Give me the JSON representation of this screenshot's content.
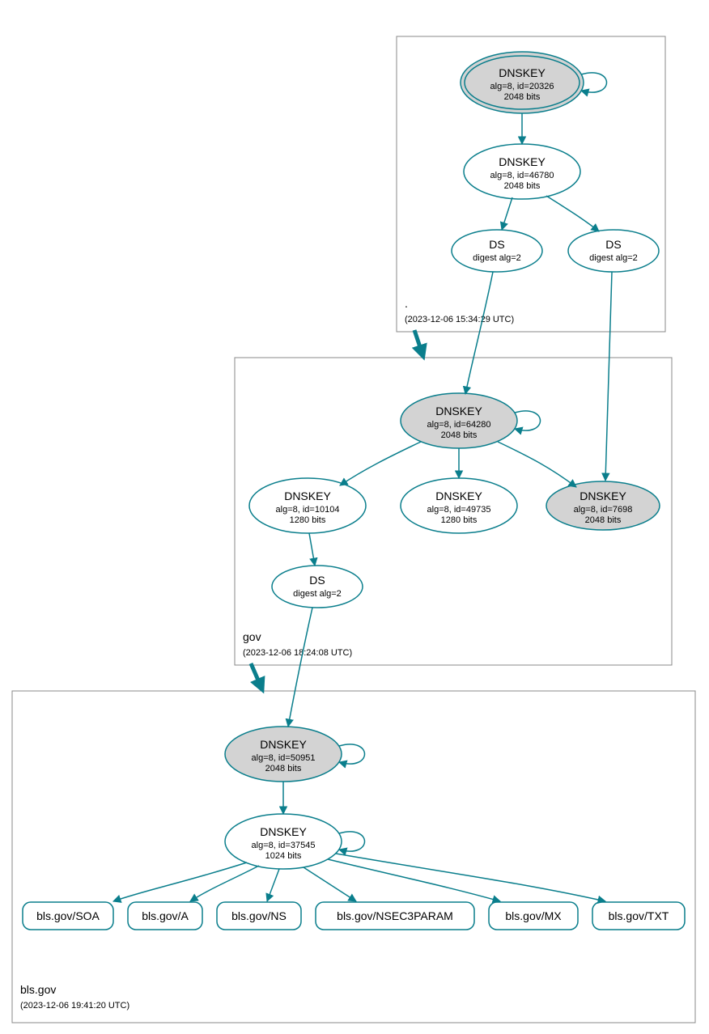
{
  "colors": {
    "stroke": "#0a7e8c",
    "fill_grey": "#d3d3d3",
    "box": "#888888"
  },
  "zones": {
    "root": {
      "label": ".",
      "timestamp": "(2023-12-06 15:34:29 UTC)",
      "nodes": {
        "ksk": {
          "title": "DNSKEY",
          "line2": "alg=8, id=20326",
          "line3": "2048 bits"
        },
        "zsk": {
          "title": "DNSKEY",
          "line2": "alg=8, id=46780",
          "line3": "2048 bits"
        },
        "ds1": {
          "title": "DS",
          "line2": "digest alg=2"
        },
        "ds2": {
          "title": "DS",
          "line2": "digest alg=2"
        }
      }
    },
    "gov": {
      "label": "gov",
      "timestamp": "(2023-12-06 18:24:08 UTC)",
      "nodes": {
        "ksk": {
          "title": "DNSKEY",
          "line2": "alg=8, id=64280",
          "line3": "2048 bits"
        },
        "zsk1": {
          "title": "DNSKEY",
          "line2": "alg=8, id=10104",
          "line3": "1280 bits"
        },
        "zsk2": {
          "title": "DNSKEY",
          "line2": "alg=8, id=49735",
          "line3": "1280 bits"
        },
        "ksk2": {
          "title": "DNSKEY",
          "line2": "alg=8, id=7698",
          "line3": "2048 bits"
        },
        "ds": {
          "title": "DS",
          "line2": "digest alg=2"
        }
      }
    },
    "bls": {
      "label": "bls.gov",
      "timestamp": "(2023-12-06 19:41:20 UTC)",
      "nodes": {
        "ksk": {
          "title": "DNSKEY",
          "line2": "alg=8, id=50951",
          "line3": "2048 bits"
        },
        "zsk": {
          "title": "DNSKEY",
          "line2": "alg=8, id=37545",
          "line3": "1024 bits"
        }
      },
      "rrsets": {
        "soa": "bls.gov/SOA",
        "a": "bls.gov/A",
        "ns": "bls.gov/NS",
        "nsec3param": "bls.gov/NSEC3PARAM",
        "mx": "bls.gov/MX",
        "txt": "bls.gov/TXT"
      }
    }
  }
}
